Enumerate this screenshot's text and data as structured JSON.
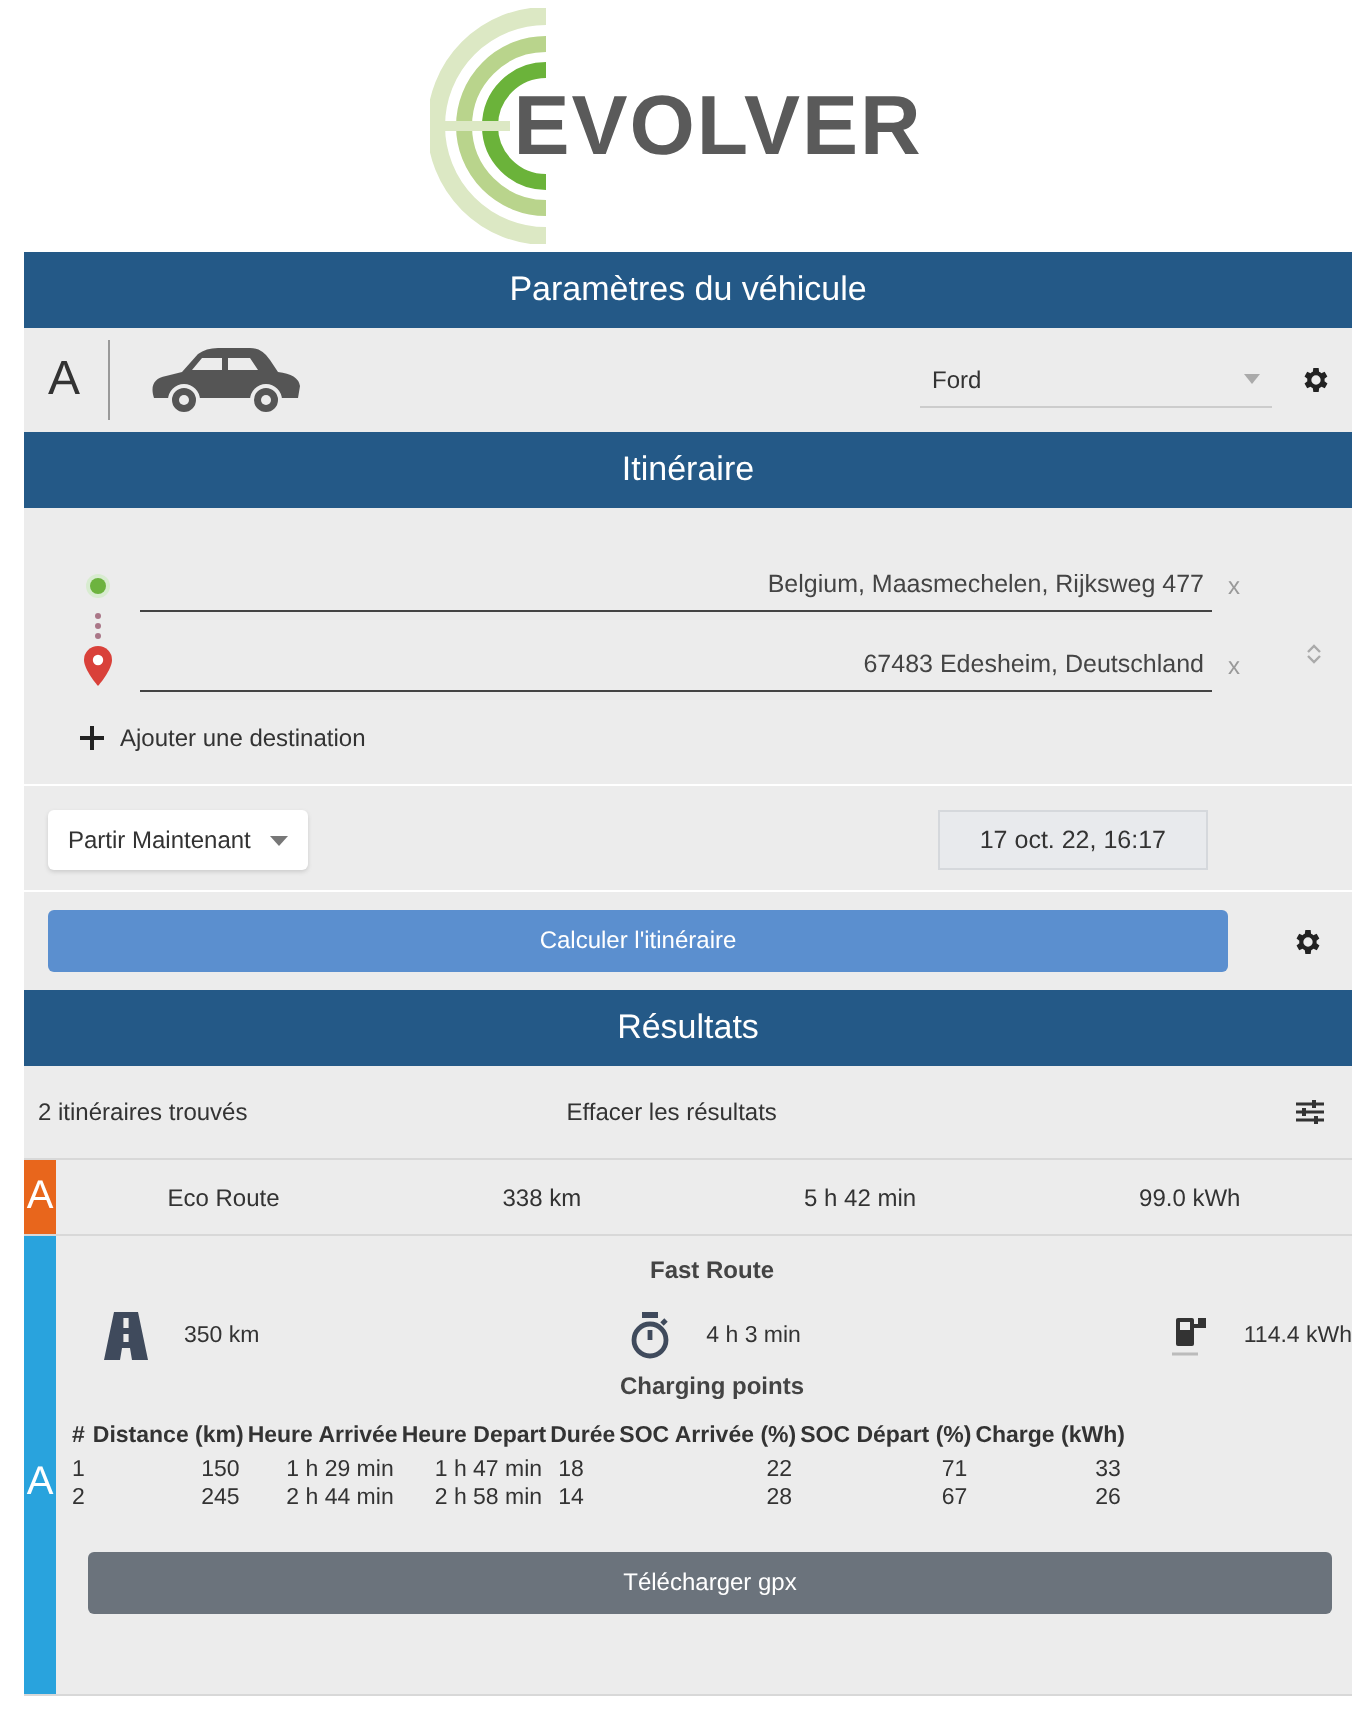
{
  "logo": {
    "text": "EVOLVER"
  },
  "vehicle": {
    "title": "Paramètres du véhicule",
    "letter": "A",
    "model": "Ford"
  },
  "itinerary": {
    "title": "Itinéraire",
    "waypoints": [
      {
        "kind": "start",
        "value": "Belgium, Maasmechelen, Rijksweg 477",
        "clear": "x"
      },
      {
        "kind": "end",
        "value": "67483 Edesheim, Deutschland",
        "clear": "x"
      }
    ],
    "add_destination": "Ajouter une destination",
    "departure": "Partir Maintenant",
    "datetime": "17 oct. 22, 16:17",
    "calculate": "Calculer l'itinéraire"
  },
  "results": {
    "title": "Résultats",
    "count": "2 itinéraires trouvés",
    "clear": "Effacer les résultats",
    "routes": [
      {
        "label": "A",
        "color": "#e8661c",
        "expanded": false,
        "name": "Eco Route",
        "distance": "338 km",
        "duration": "5 h 42 min",
        "energy": "99.0 kWh"
      },
      {
        "label": "A",
        "color": "#29a3dd",
        "expanded": true,
        "name": "Fast Route",
        "distance": "350 km",
        "duration": "4 h 3 min",
        "energy": "114.4 kWh",
        "charging_title": "Charging points",
        "table": {
          "columns": [
            "#",
            "Distance (km)",
            "Heure Arrivée",
            "Heure Depart",
            "Durée",
            "SOC Arrivée (%)",
            "SOC Départ (%)",
            "Charge (kWh)"
          ],
          "rows": [
            [
              "1",
              "150",
              "1 h 29 min",
              "1 h 47 min",
              "18",
              "22",
              "71",
              "33"
            ],
            [
              "2",
              "245",
              "2 h 44 min",
              "2 h 58 min",
              "14",
              "28",
              "67",
              "26"
            ]
          ]
        },
        "download": "Télécharger gpx"
      }
    ]
  }
}
